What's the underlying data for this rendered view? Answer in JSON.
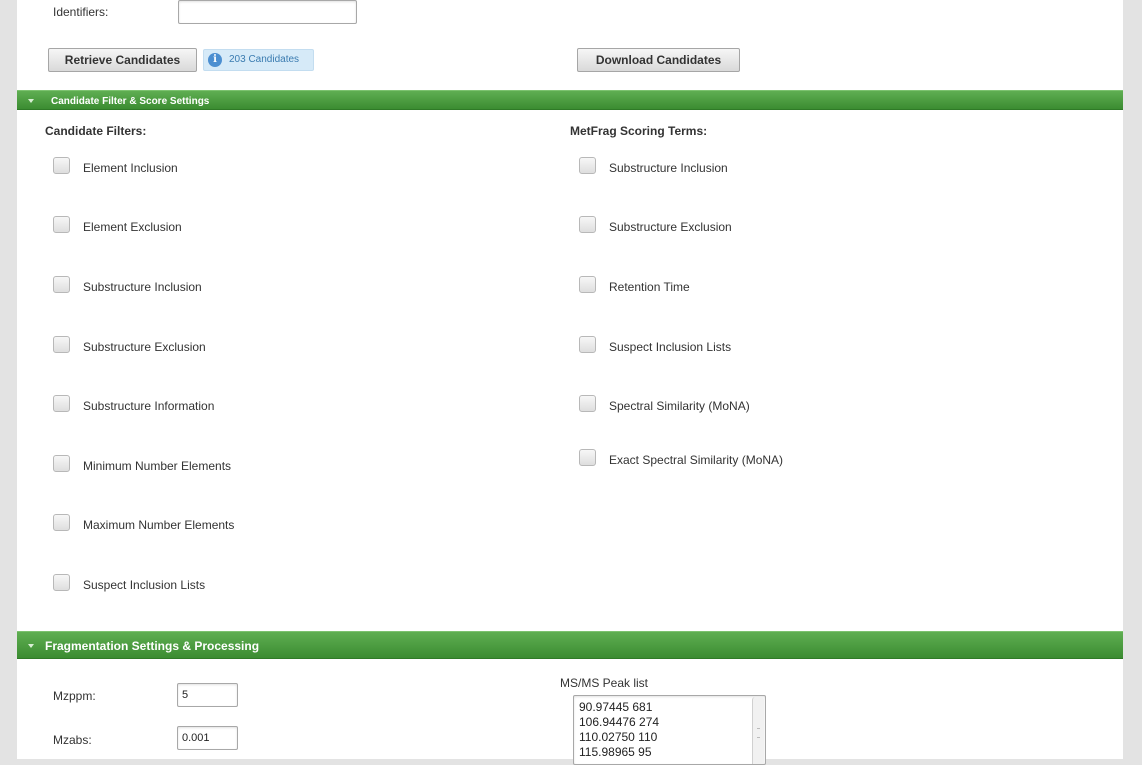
{
  "identifiers": {
    "label": "Identifiers:",
    "value": ""
  },
  "retrieve_button": "Retrieve Candidates",
  "candidate_count": "203 Candidates",
  "download_button": "Download Candidates",
  "filter_section": {
    "title": "Candidate Filter & Score Settings",
    "filters_heading": "Candidate Filters:",
    "filters": [
      "Element Inclusion",
      "Element Exclusion",
      "Substructure Inclusion",
      "Substructure Exclusion",
      "Substructure Information",
      "Minimum Number Elements",
      "Maximum Number Elements",
      "Suspect Inclusion Lists"
    ],
    "scoring_heading": "MetFrag Scoring Terms:",
    "scoring_terms": [
      "Substructure Inclusion",
      "Substructure Exclusion",
      "Retention Time",
      "Suspect Inclusion Lists",
      "Spectral Similarity (MoNA)",
      "Exact Spectral Similarity (MoNA)"
    ]
  },
  "fragmentation_section": {
    "title": "Fragmentation Settings & Processing",
    "mzppm": {
      "label": "Mzppm:",
      "value": "5"
    },
    "mzabs": {
      "label": "Mzabs:",
      "value": "0.001"
    },
    "peak_list_label": "MS/MS Peak list",
    "peak_list": [
      "90.97445 681",
      "106.94476 274",
      "110.02750 110",
      "115.98965 95"
    ]
  },
  "colors": {
    "section_bar": "#4a9d3f",
    "badge_bg": "#d6eaf8",
    "page_bg": "#e3e3e3"
  }
}
